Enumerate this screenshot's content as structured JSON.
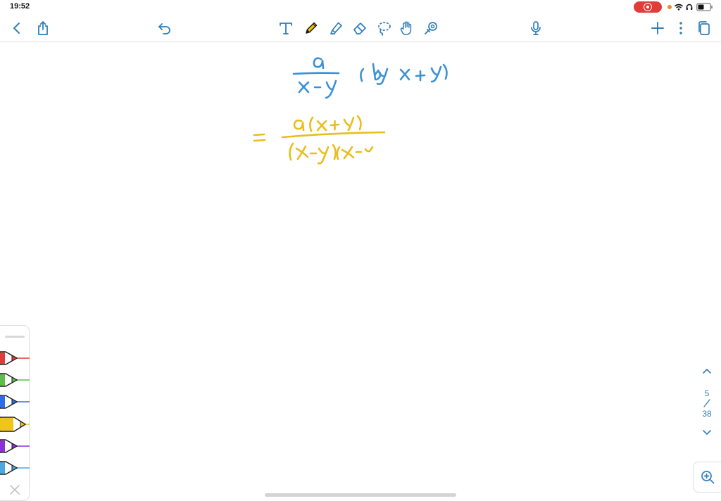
{
  "status_bar": {
    "time": "19:52",
    "recording_color": "#e23b3b",
    "indicator_dot_color": "#f08a24"
  },
  "toolbar": {
    "left_icons": [
      "chevron-left-icon",
      "share-icon",
      "undo-icon"
    ],
    "center_tools": [
      "text-tool-icon",
      "pencil-icon",
      "highlighter-icon",
      "eraser-icon",
      "lasso-icon",
      "hand-tool-icon",
      "laser-pointer-icon"
    ],
    "active_tool": "pencil-icon",
    "active_tool_color": "#f2c200",
    "right_icons": [
      "microphone-icon",
      "plus-icon",
      "more-vertical-icon",
      "pages-icon"
    ],
    "accent_color": "#2e7fb8"
  },
  "notes": {
    "ink_colors": {
      "blue": "#3a92d4",
      "yellow": "#e9bd1d"
    }
  },
  "pen_tray": {
    "pens": [
      {
        "name": "red-pen",
        "color": "#e03c3c"
      },
      {
        "name": "green-pen",
        "color": "#5cbd4a"
      },
      {
        "name": "blue-pen",
        "color": "#2b6fe8"
      },
      {
        "name": "yellow-pen",
        "color": "#f0c419",
        "selected": true
      },
      {
        "name": "purple-pen",
        "color": "#8e2ed6"
      },
      {
        "name": "light-blue-pen",
        "color": "#4aa8e2"
      }
    ]
  },
  "page_nav": {
    "current": "5",
    "total": "38"
  }
}
